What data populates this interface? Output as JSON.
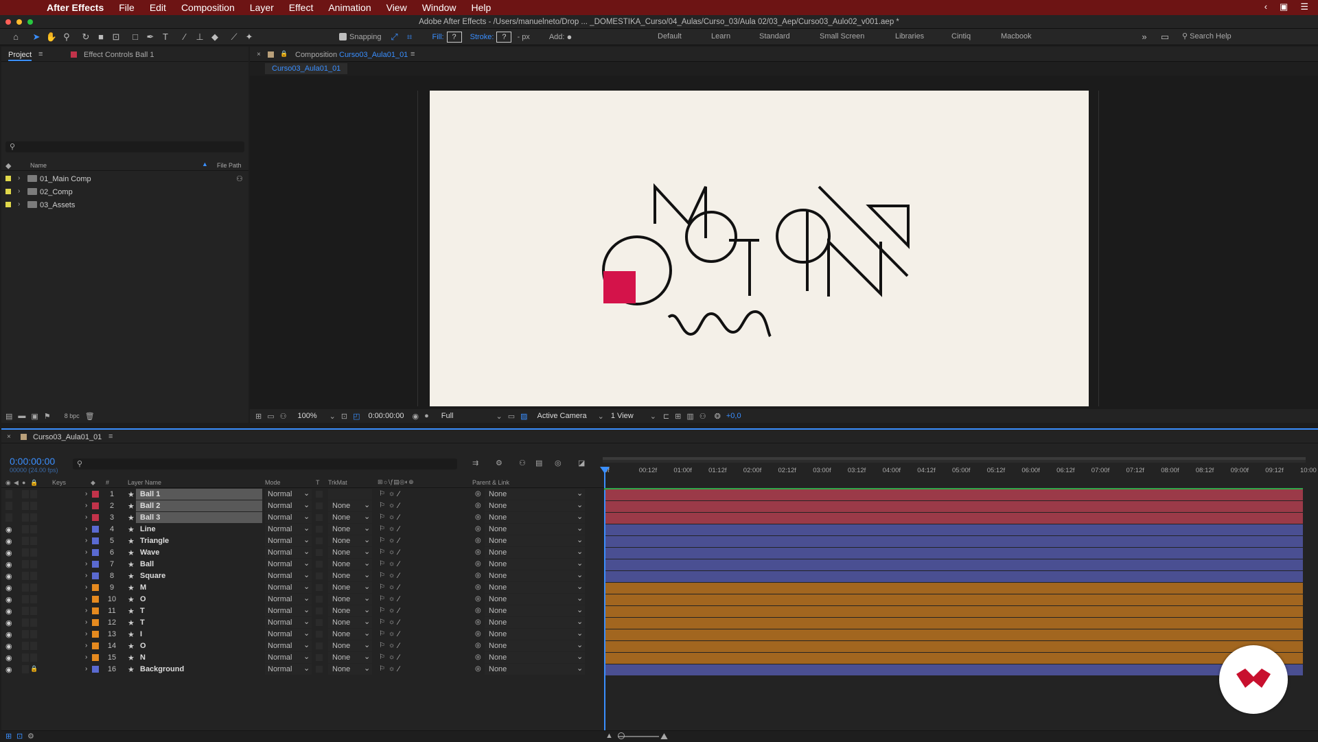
{
  "menubar": {
    "app_name": "After Effects",
    "items": [
      "File",
      "Edit",
      "Composition",
      "Layer",
      "Effect",
      "Animation",
      "View",
      "Window",
      "Help"
    ]
  },
  "titlebar": {
    "path": "Adobe After Effects - /Users/manuelneto/Drop ... _DOMESTIKA_Curso/04_Aulas/Curso_03/Aula 02/03_Aep/Curso03_Aulo02_v001.aep *"
  },
  "toolbar": {
    "snapping_label": "Snapping",
    "fill_label": "Fill:",
    "stroke_label": "Stroke:",
    "px_label": "- px",
    "add_label": "Add:",
    "workspaces": [
      "Default",
      "Learn",
      "Standard",
      "Small Screen",
      "Libraries",
      "Cintiq",
      "Macbook"
    ],
    "search_placeholder": "Search Help"
  },
  "project_panel": {
    "tab_project": "Project",
    "tab_effect_controls": "Effect Controls Ball 1",
    "col_name": "Name",
    "col_filepath": "File Path",
    "items": [
      {
        "name": "01_Main Comp",
        "color": "#e0d84a"
      },
      {
        "name": "02_Comp",
        "color": "#e0d84a"
      },
      {
        "name": "03_Assets",
        "color": "#e0d84a"
      }
    ],
    "bpc": "8 bpc"
  },
  "composition_panel": {
    "tab_prefix": "Composition",
    "comp_name": "Curso03_Aula01_01",
    "sub_tab": "Curso03_Aula01_01"
  },
  "viewer_bar": {
    "zoom": "100%",
    "timecode": "0:00:00:00",
    "resolution": "Full",
    "camera": "Active Camera",
    "views": "1 View",
    "exposure": "+0,0"
  },
  "timeline": {
    "tab": "Curso03_Aula01_01",
    "timecode": "0:00:00:00",
    "frame_info": "00000 (24.00 fps)",
    "headers": {
      "keys": "Keys",
      "num": "#",
      "layer_name": "Layer Name",
      "mode": "Mode",
      "t": "T",
      "trkmat": "TrkMat",
      "parent": "Parent & Link"
    },
    "ruler": [
      "0f",
      "00:12f",
      "01:00f",
      "01:12f",
      "02:00f",
      "02:12f",
      "03:00f",
      "03:12f",
      "04:00f",
      "04:12f",
      "05:00f",
      "05:12f",
      "06:00f",
      "06:12f",
      "07:00f",
      "07:12f",
      "08:00f",
      "08:12f",
      "09:00f",
      "09:12f",
      "10:00"
    ],
    "layers": [
      {
        "num": "1",
        "name": "Ball 1",
        "mode": "Normal",
        "trkmat": "",
        "parent": "None",
        "color": "#c2334a",
        "bar": "#9b3a48",
        "selected": true,
        "visible": false
      },
      {
        "num": "2",
        "name": "Ball 2",
        "mode": "Normal",
        "trkmat": "None",
        "parent": "None",
        "color": "#c2334a",
        "bar": "#9b3a48",
        "selected": true,
        "visible": false
      },
      {
        "num": "3",
        "name": "Ball 3",
        "mode": "Normal",
        "trkmat": "None",
        "parent": "None",
        "color": "#c2334a",
        "bar": "#9b3a48",
        "selected": true,
        "visible": false
      },
      {
        "num": "4",
        "name": "Line",
        "mode": "Normal",
        "trkmat": "None",
        "parent": "None",
        "color": "#5a6ad1",
        "bar": "#4a4f92",
        "selected": false,
        "visible": true
      },
      {
        "num": "5",
        "name": "Triangle",
        "mode": "Normal",
        "trkmat": "None",
        "parent": "None",
        "color": "#5a6ad1",
        "bar": "#4a4f92",
        "selected": false,
        "visible": true
      },
      {
        "num": "6",
        "name": "Wave",
        "mode": "Normal",
        "trkmat": "None",
        "parent": "None",
        "color": "#5a6ad1",
        "bar": "#4a4f92",
        "selected": false,
        "visible": true
      },
      {
        "num": "7",
        "name": "Ball",
        "mode": "Normal",
        "trkmat": "None",
        "parent": "None",
        "color": "#5a6ad1",
        "bar": "#4a4f92",
        "selected": false,
        "visible": true
      },
      {
        "num": "8",
        "name": "Square",
        "mode": "Normal",
        "trkmat": "None",
        "parent": "None",
        "color": "#5a6ad1",
        "bar": "#4a4f92",
        "selected": false,
        "visible": true
      },
      {
        "num": "9",
        "name": "M",
        "mode": "Normal",
        "trkmat": "None",
        "parent": "None",
        "color": "#e58a1f",
        "bar": "#a2661f",
        "selected": false,
        "visible": true
      },
      {
        "num": "10",
        "name": "O",
        "mode": "Normal",
        "trkmat": "None",
        "parent": "None",
        "color": "#e58a1f",
        "bar": "#a2661f",
        "selected": false,
        "visible": true
      },
      {
        "num": "11",
        "name": "T",
        "mode": "Normal",
        "trkmat": "None",
        "parent": "None",
        "color": "#e58a1f",
        "bar": "#a2661f",
        "selected": false,
        "visible": true
      },
      {
        "num": "12",
        "name": "T",
        "mode": "Normal",
        "trkmat": "None",
        "parent": "None",
        "color": "#e58a1f",
        "bar": "#a2661f",
        "selected": false,
        "visible": true
      },
      {
        "num": "13",
        "name": "I",
        "mode": "Normal",
        "trkmat": "None",
        "parent": "None",
        "color": "#e58a1f",
        "bar": "#a2661f",
        "selected": false,
        "visible": true
      },
      {
        "num": "14",
        "name": "O",
        "mode": "Normal",
        "trkmat": "None",
        "parent": "None",
        "color": "#e58a1f",
        "bar": "#a2661f",
        "selected": false,
        "visible": true
      },
      {
        "num": "15",
        "name": "N",
        "mode": "Normal",
        "trkmat": "None",
        "parent": "None",
        "color": "#e58a1f",
        "bar": "#a2661f",
        "selected": false,
        "visible": true
      },
      {
        "num": "16",
        "name": "Background",
        "mode": "Normal",
        "trkmat": "None",
        "parent": "None",
        "color": "#5a6ad1",
        "bar": "#4a4f92",
        "selected": false,
        "visible": true,
        "locked": true
      }
    ]
  },
  "colors": {
    "accent": "#3a8fff",
    "menubar_bg": "#6d1414",
    "red_square": "#d4134a",
    "canvas_bg": "#f4f0e8"
  }
}
